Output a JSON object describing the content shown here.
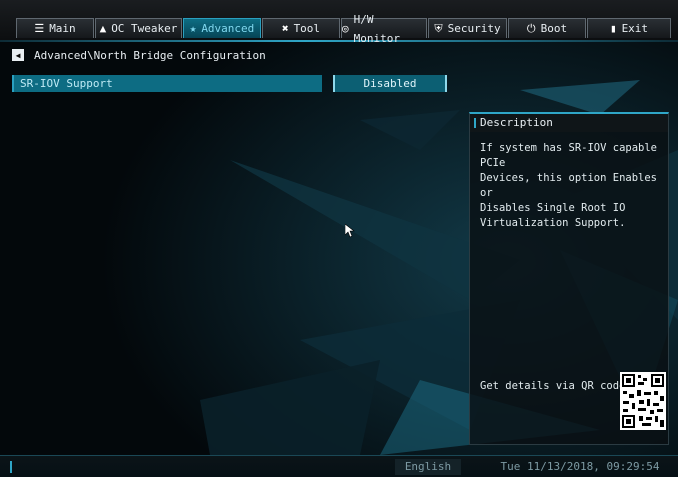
{
  "tabs": [
    {
      "label": "Main",
      "icon": "list-icon",
      "glyph": "☰"
    },
    {
      "label": "OC Tweaker",
      "icon": "rocket-icon",
      "glyph": "▲"
    },
    {
      "label": "Advanced",
      "icon": "star-icon",
      "glyph": "★",
      "active": true
    },
    {
      "label": "Tool",
      "icon": "wrench-icon",
      "glyph": "✖"
    },
    {
      "label": "H/W Monitor",
      "icon": "gauge-icon",
      "glyph": "◎"
    },
    {
      "label": "Security",
      "icon": "shield-icon",
      "glyph": "⛨"
    },
    {
      "label": "Boot",
      "icon": "power-icon",
      "glyph": "⏻"
    },
    {
      "label": "Exit",
      "icon": "door-icon",
      "glyph": "▮"
    }
  ],
  "breadcrumb": {
    "text": "Advanced\\North Bridge Configuration"
  },
  "options": [
    {
      "label": "SR-IOV Support",
      "value": "Disabled"
    }
  ],
  "description": {
    "title": "Description",
    "lines": [
      "If system has SR-IOV capable PCIe",
      "Devices, this option Enables or",
      "Disables Single Root IO",
      "Virtualization Support."
    ],
    "qr_label": "Get details via QR code"
  },
  "status": {
    "language": "English",
    "datetime": "Tue 11/13/2018, 09:29:54"
  },
  "colors": {
    "accent": "#2fa6c7",
    "selected_row": "#0d6c83",
    "background": "#04090c"
  }
}
